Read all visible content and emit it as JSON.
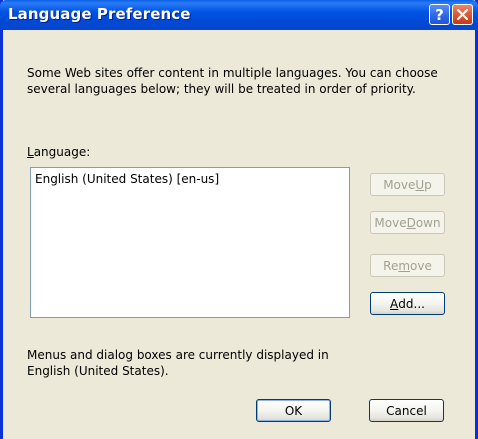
{
  "window": {
    "title": "Language Preference",
    "help_glyph": "?",
    "close_glyph": "×"
  },
  "description": "Some Web sites offer content in multiple languages. You can choose several languages below; they will be treated in order of priority.",
  "language_label": {
    "underlined": "L",
    "rest": "anguage:"
  },
  "languages": [
    "English (United States) [en-us]"
  ],
  "buttons": {
    "move_up": {
      "before": "Move ",
      "underlined": "U",
      "after": "p",
      "enabled": false
    },
    "move_down": {
      "before": "Move ",
      "underlined": "D",
      "after": "own",
      "enabled": false
    },
    "remove": {
      "before": "Re",
      "underlined": "m",
      "after": "ove",
      "enabled": false
    },
    "add": {
      "before": "",
      "underlined": "A",
      "after": "dd...",
      "enabled": true
    },
    "ok": "OK",
    "cancel": "Cancel"
  },
  "footer_note": "Menus and dialog boxes are currently displayed in English (United States).",
  "colors": {
    "titlebar": "#0054e3",
    "window_border": "#0831d9",
    "dialog_bg": "#ece9d8",
    "close_button": "#d8502c",
    "disabled_text": "#a1a192"
  },
  "icons": {
    "help": "help-icon",
    "close": "close-icon"
  }
}
